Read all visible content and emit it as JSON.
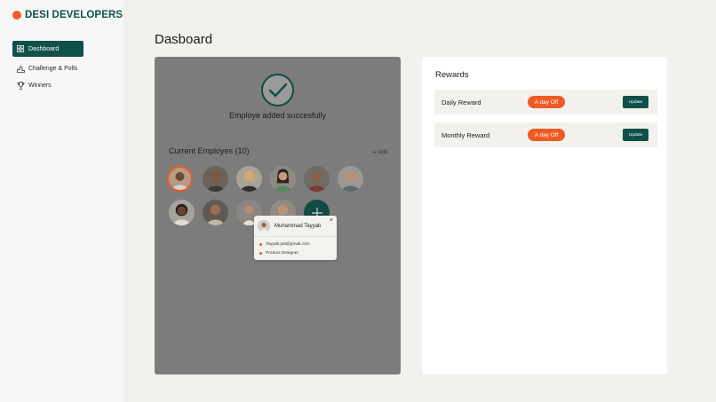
{
  "brand": {
    "name": "DESI DEVELOPERS",
    "accent": "#f05a24",
    "primary": "#0f5149"
  },
  "sidebar": {
    "items": [
      {
        "label": "Dashboard",
        "icon": "grid-icon",
        "active": true
      },
      {
        "label": "Challenge & Polls",
        "icon": "podium-icon",
        "active": false
      },
      {
        "label": "Winners",
        "icon": "trophy-icon",
        "active": false
      }
    ]
  },
  "page": {
    "title": "Dasboard"
  },
  "employees": {
    "success_message": "Employe added succesfully",
    "title": "Current Employes (10)",
    "add_label": "Add",
    "popup": {
      "name": "Muhammad Tayyab",
      "email": "Tayyab.jutt@gmail.com",
      "role": "Product Designer",
      "close": "×"
    }
  },
  "rewards": {
    "title": "Rewards",
    "items": [
      {
        "name": "Daily Reward",
        "badge": "A day Off",
        "button": "Update"
      },
      {
        "name": "Monthly Reward",
        "badge": "A day Off",
        "button": "Update"
      }
    ]
  }
}
